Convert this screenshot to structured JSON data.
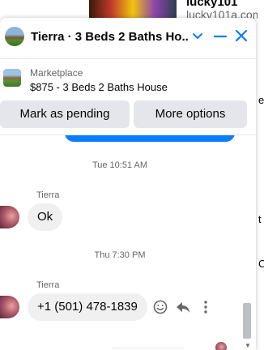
{
  "background": {
    "ad_title": "lucky101",
    "ad_url": "lucky101a.com",
    "edge_letters": [
      "e",
      "t",
      "C"
    ]
  },
  "chat": {
    "header_title": "Tierra · 3 Beds 2 Baths Ho...",
    "listing_label": "Marketplace",
    "listing_price": "$875 - 3 Beds 2 Baths House",
    "mark_pending_label": "Mark as pending",
    "more_options_label": "More options",
    "messages": [
      {
        "timestamp": "Tue 10:51 AM",
        "sender": "Tierra",
        "text": "Ok"
      },
      {
        "timestamp": "Thu 7:30 PM",
        "sender": "Tierra",
        "text": "+1 (501) 478-1839"
      }
    ]
  },
  "colors": {
    "accent": "#0a7cff",
    "bubble_received": "#f0f0f0",
    "button_bg": "#e4e6eb",
    "muted_text": "#65676b"
  },
  "icons": [
    "chevron-down-icon",
    "minimize-icon",
    "close-icon",
    "emoji-icon",
    "reply-icon",
    "more-vertical-icon"
  ]
}
